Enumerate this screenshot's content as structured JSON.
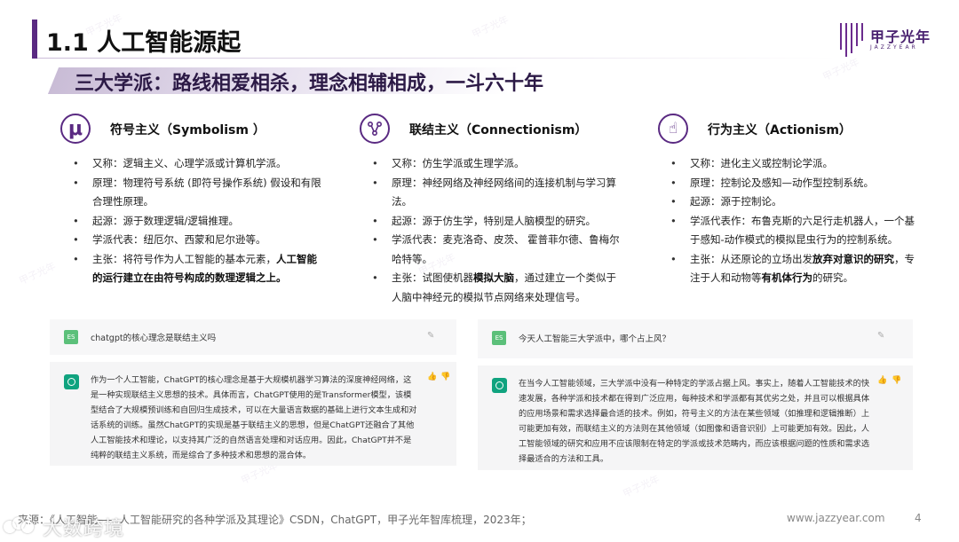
{
  "watermark": "甲子光年",
  "header": {
    "title": "1.1 人工智能源起",
    "logo_name": "甲子光年",
    "logo_sub": "JAZZYEAR",
    "subtitle": "三大学派：路线相爱相杀，理念相辅相成，一斗六十年",
    "accent_color": "#5a2a82"
  },
  "columns": [
    {
      "icon": "mu-symbol-icon",
      "icon_glyph": "μ",
      "title": "符号主义（Symbolism ）",
      "items": [
        {
          "text": "又称：逻辑主义、心理学派或计算机学派。"
        },
        {
          "text": "原理：物理符号系统 (即符号操作系统) 假设和有限合理性原理。"
        },
        {
          "text": "起源：源于数理逻辑/逻辑推理。"
        },
        {
          "text": "学派代表：纽厄尔、西蒙和尼尔逊等。"
        },
        {
          "text": "主张：将符号作为人工智能的基本元素，",
          "bold": "人工智能的运行建立在由符号构成的数理逻辑之上。"
        }
      ]
    },
    {
      "icon": "network-node-icon",
      "icon_glyph": "⧖",
      "title": "联结主义（Connectionism）",
      "items": [
        {
          "text": "又称：仿生学派或生理学派。"
        },
        {
          "text": "原理：神经网络及神经网络间的连接机制与学习算法。"
        },
        {
          "text": "起源：源于仿生学，特别是人脑模型的研究。"
        },
        {
          "text": "学派代表：麦克洛奇、皮茨、 霍普菲尔德、鲁梅尔哈特等。"
        },
        {
          "text": "主张：试图使机器",
          "bold": "模拟大脑",
          "after": "，通过建立一个类似于人脑中神经元的模拟节点网络来处理信号。"
        }
      ]
    },
    {
      "icon": "hand-pointer-icon",
      "icon_glyph": "☝",
      "title": "行为主义（Actionism）",
      "items": [
        {
          "text": "又称：进化主义或控制论学派。"
        },
        {
          "text": "原理：控制论及感知—动作型控制系统。"
        },
        {
          "text": "起源：源于控制论。"
        },
        {
          "text": "学派代表作：布鲁克斯的六足行走机器人，一个基于感知-动作模式的模拟昆虫行为的控制系统。"
        },
        {
          "text": "主张：从还原论的立场出发",
          "bold": "放弃对意识的研究",
          "after": "，专注于人和动物等",
          "bold2": "有机体行为",
          "after2": "的研究。"
        }
      ]
    }
  ],
  "chats": [
    {
      "avatar": "ES",
      "question": "chatgpt的核心理念是联结主义吗",
      "answer": "作为一个人工智能，ChatGPT的核心理念是基于大规模机器学习算法的深度神经网络，这是一种实现联结主义思想的技术。具体而言，ChatGPT使用的是Transformer模型，该模型结合了大规模预训练和自回归生成技术，可以在大量语言数据的基础上进行文本生成和对话系统的训练。虽然ChatGPT的实现是基于联结主义的思想，但是ChatGPT还融合了其他人工智能技术和理论，以支持其广泛的自然语言处理和对话应用。因此，ChatGPT并不是纯粹的联结主义系统，而是综合了多种技术和思想的混合体。"
    },
    {
      "avatar": "ES",
      "question": "今天人工智能三大学派中，哪个占上风？",
      "answer": "在当今人工智能领域，三大学派中没有一种特定的学派占据上风。事实上，随着人工智能技术的快速发展，各种学派和技术都在得到广泛应用，每种技术和学派都有其优劣之处，并且可以根据具体的应用场景和需求选择最合适的技术。例如，符号主义的方法在某些领域（如推理和逻辑推断）上可能更加有效，而联结主义的方法则在其他领域（如图像和语音识别）上可能更加有效。因此，人工智能领域的研究和应用不应该限制在特定的学派或技术范畴内，而应该根据问题的性质和需求选择最适合的方法和工具。"
    }
  ],
  "footer": {
    "source": "来源：《人工智能——人工智能研究的各种学派及其理论》CSDN，ChatGPT，甲子光年智库梳理，2023年；",
    "url": "www.jazzyear.com",
    "page": "4",
    "brand": "大数跨境"
  }
}
